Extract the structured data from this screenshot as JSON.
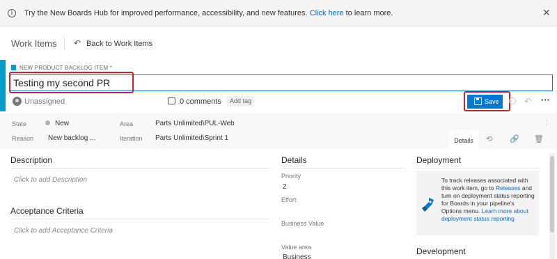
{
  "banner": {
    "message": "Try the New Boards Hub for improved performance, accessibility, and new features.",
    "link": "Click here",
    "suffix": " to learn more."
  },
  "header": {
    "title": "Work Items",
    "back_label": "Back to Work Items"
  },
  "work_item": {
    "type_label": "NEW PRODUCT BACKLOG ITEM *",
    "title": "Testing my second PR",
    "assignee": "Unassigned",
    "comments": "0 comments",
    "add_tag": "Add tag",
    "save_label": "Save"
  },
  "fields": {
    "state_label": "State",
    "state_value": "New",
    "reason_label": "Reason",
    "reason_value": "New backlog ...",
    "area_label": "Area",
    "area_value": "Parts Unlimited\\PUL-Web",
    "iteration_label": "Iteration",
    "iteration_value": "Parts Unlimited\\Sprint 1"
  },
  "tabs": {
    "details": "Details"
  },
  "sections": {
    "description": "Description",
    "description_placeholder": "Click to add Description",
    "acceptance": "Acceptance Criteria",
    "acceptance_placeholder": "Click to add Acceptance Criteria",
    "details": "Details",
    "deployment": "Deployment",
    "development": "Development"
  },
  "details": {
    "priority_label": "Priority",
    "priority_value": "2",
    "effort_label": "Effort",
    "business_value_label": "Business Value",
    "value_area_label": "Value area",
    "value_area_value": "Business"
  },
  "deployment": {
    "text_1": "To track releases associated with this work item, go to ",
    "link_1": "Releases",
    "text_2": " and turn on deployment status reporting for Boards in your pipeline's Options menu. ",
    "link_2": "Learn more about deployment status reporting"
  },
  "colors": {
    "accent": "#009ccc",
    "primary": "#0078d4",
    "highlight": "#d21e2b"
  }
}
